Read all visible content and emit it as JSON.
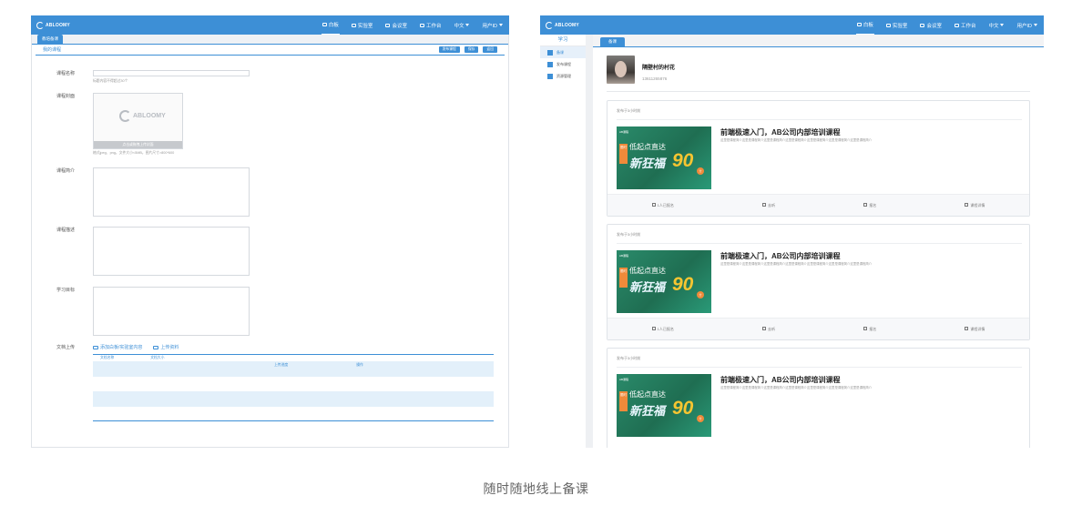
{
  "colors": {
    "accent": "#3d8fd6",
    "panel": "#f2f3f5",
    "row_alt": "#e3f0fa"
  },
  "caption": "随时随地线上备课",
  "topbar": {
    "logo_text": "ABLOOMY",
    "nav": [
      {
        "label": "白板",
        "icon": "whiteboard-icon"
      },
      {
        "label": "实验室",
        "icon": "lab-icon"
      },
      {
        "label": "会议室",
        "icon": "meeting-icon"
      },
      {
        "label": "工作台",
        "icon": "workbench-icon"
      },
      {
        "label": "中文",
        "icon": "chevron-down-icon"
      },
      {
        "label": "用户ID",
        "icon": "chevron-down-icon"
      }
    ]
  },
  "left": {
    "tab": "教培备课",
    "title": "我的课程",
    "buttons": [
      "发布课程",
      "保存",
      "返回"
    ],
    "fields": {
      "name_label": "课程名称",
      "name_hint": "标题内容不得超过30个",
      "cover_label": "课程封面",
      "cover_logo": "ABLOOMY",
      "cover_bar": "点击或拖拽上传封面",
      "cover_hint": "格式jpeg、png，文件大小<5MB，图片尺寸>800*600",
      "intro_label": "课程简介",
      "desc_label": "课程描述",
      "goal_label": "学习目标",
      "upload_label": "文档上传"
    },
    "upload_actions": [
      "添加白板/实验室内容",
      "上传资料"
    ],
    "table_headers": [
      "文档名称",
      "文档大小"
    ],
    "table_row_cols": [
      "上传进度",
      "操作"
    ]
  },
  "right": {
    "sidebar_title": "学习",
    "sidebar_items": [
      "备课",
      "发布课程",
      "资源管理"
    ],
    "tab": "备课",
    "profile": {
      "name": "隔壁村的村花",
      "phone": "13611265876"
    },
    "cards": [
      {
        "time": "发布于3小时前",
        "title": "前端极速入门，AB公司内部培训课程",
        "desc": "这里是课程简介这里是课程简介这里是课程简介这里是课程简介这里是课程简介这里是课程简介这里是课程简介",
        "thumb_tag": "AB课程",
        "thumb_badge": "限时",
        "thumb_line1": "低起点直达",
        "thumb_line2": "新狂福",
        "thumb_num": "90",
        "thumb_unit": "分"
      },
      {
        "time": "发布于3小时前",
        "title": "前端极速入门，AB公司内部培训课程",
        "desc": "这里是课程简介这里是课程简介这里是课程简介这里是课程简介这里是课程简介这里是课程简介这里是课程简介",
        "thumb_tag": "AB课程",
        "thumb_badge": "限时",
        "thumb_line1": "低起点直达",
        "thumb_line2": "新狂福",
        "thumb_num": "90",
        "thumb_unit": "分"
      },
      {
        "time": "发布于3小时前",
        "title": "前端极速入门，AB公司内部培训课程",
        "desc": "这里是课程简介这里是课程简介这里是课程简介这里是课程简介这里是课程简介这里是课程简介这里是课程简介",
        "thumb_tag": "AB课程",
        "thumb_badge": "限时",
        "thumb_line1": "低起点直达",
        "thumb_line2": "新狂福",
        "thumb_num": "90",
        "thumb_unit": "分"
      }
    ],
    "card_foot": [
      "1人已报名",
      "去听",
      "报名",
      "课程详情"
    ]
  }
}
